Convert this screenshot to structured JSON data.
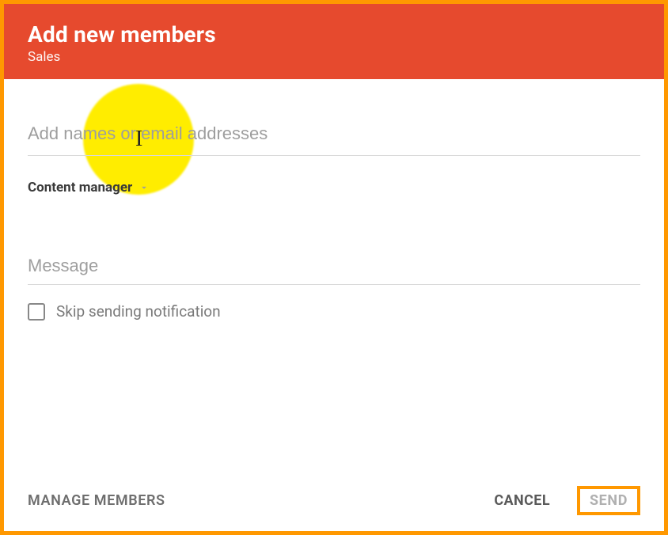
{
  "header": {
    "title": "Add new members",
    "subtitle": "Sales"
  },
  "form": {
    "names_placeholder": "Add names or email addresses",
    "role": "Content manager",
    "message_placeholder": "Message",
    "skip_label": "Skip sending notification"
  },
  "footer": {
    "manage": "MANAGE MEMBERS",
    "cancel": "CANCEL",
    "send": "SEND"
  },
  "annotations": {
    "highlight_color": "#ffed00",
    "border_color": "#ff9800"
  }
}
